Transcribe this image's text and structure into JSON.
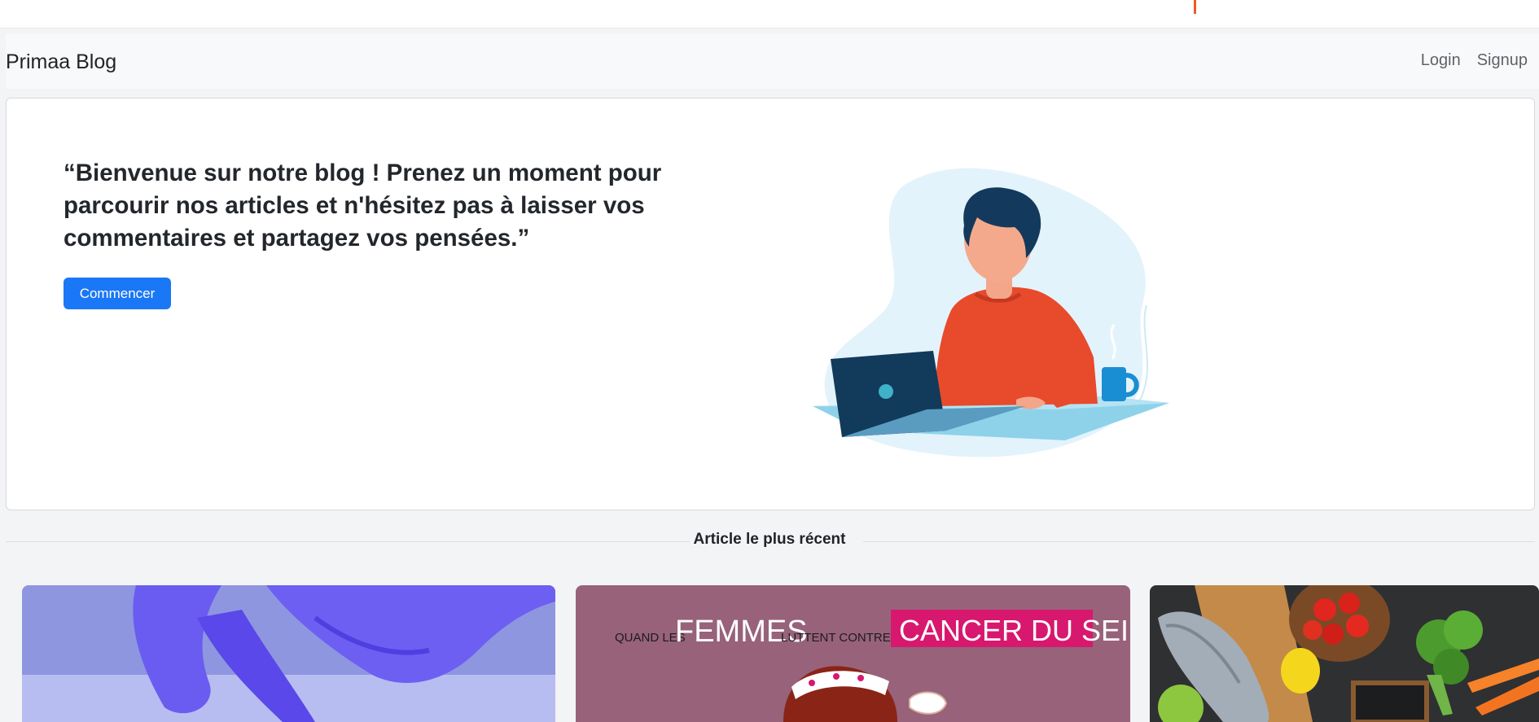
{
  "navbar": {
    "brand": "Primaa Blog",
    "links": [
      "Login",
      "Signup"
    ]
  },
  "hero": {
    "quote": "“Bienvenue sur notre blog ! Prenez un moment pour parcourir nos articles et n'hésitez pas à laisser vos commentaires et partagez vos pensées.”",
    "cta_label": "Commencer"
  },
  "latest": {
    "section_title": "Article le plus récent",
    "cards": [
      {
        "image": "purple-gloved-hand-photo"
      },
      {
        "image": "breast-cancer-poster",
        "text_small_1": "QUAND LES",
        "text_big": "FEMMES",
        "text_small_2": "LUTTENT CONTRE LE",
        "text_highlight": "CANCER DU SEIN"
      },
      {
        "image": "healthy-food-photo"
      }
    ]
  },
  "colors": {
    "primary": "#1a77f5",
    "page_background": "#f3f4f6",
    "navbar_background": "#f8f9fa",
    "poster_background": "#97627a",
    "poster_highlight": "#d7186e"
  }
}
